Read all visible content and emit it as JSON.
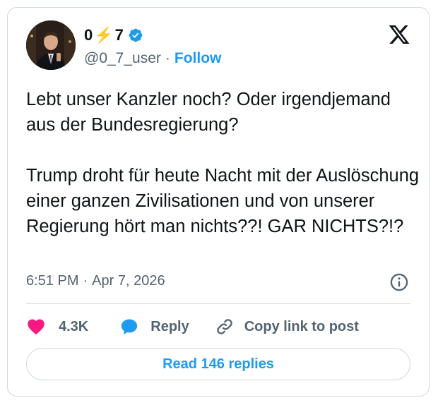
{
  "author": {
    "name_prefix": "0",
    "name_bolt": "⚡",
    "name_suffix": "7",
    "handle": "@0_7_user",
    "separator": "·",
    "follow_label": "Follow"
  },
  "tweet": {
    "paragraph_1": "Lebt unser Kanzler noch? Oder irgendjemand aus der Bundesregierung?",
    "paragraph_2": "Trump  droht für heute Nacht mit der Auslöschung einer ganzen Zivilisationen und von unserer Regierung hört man nichts??! GAR NICHTS?!?",
    "time": "6:51 PM",
    "separator": "·",
    "date": "Apr 7, 2026"
  },
  "actions": {
    "likes_count": "4.3K",
    "reply_label": "Reply",
    "copy_label": "Copy link to post"
  },
  "read_replies_label": "Read 146 replies",
  "colors": {
    "accent": "#1d9bf0",
    "like": "#f91880",
    "muted": "#536471",
    "border": "#cfd9de"
  },
  "icons": [
    "verified-badge-icon",
    "x-logo-icon",
    "info-icon",
    "heart-icon",
    "reply-bubble-icon",
    "link-icon"
  ]
}
